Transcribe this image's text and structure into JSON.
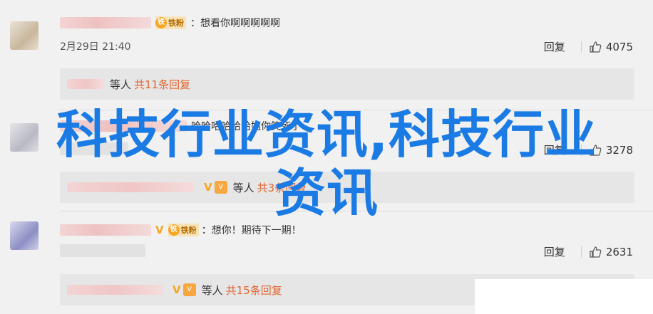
{
  "comments": [
    {
      "badge": "铁粉",
      "text": "：想看你啊啊啊啊啊",
      "time": "2月29日 21:40",
      "reply_label": "回复",
      "likes": "4075",
      "reply_summary": {
        "people": "等人",
        "count": "共11条回复"
      }
    },
    {
      "text": "哈哈哈哈哈哈姐你笑死了",
      "reply_label": "回复",
      "likes": "3278",
      "reply_summary": {
        "people": "等人",
        "count": "共3条回复"
      }
    },
    {
      "badge": "铁粉",
      "text": "：想你！期待下一期！",
      "reply_label": "回复",
      "likes": "2631",
      "reply_summary": {
        "people": "等人",
        "count": "共15条回复"
      }
    }
  ],
  "watermark": {
    "line1": "科技行业资讯,科技行业",
    "line2": "资讯"
  },
  "colors": {
    "link_orange": "#e3632d",
    "watermark_blue": "#1b7be4",
    "badge_gold": "#f6a623"
  },
  "icons": {
    "like": "thumb-up-icon",
    "vip": "vip-badge-icon",
    "fan": "fan-badge-icon"
  }
}
